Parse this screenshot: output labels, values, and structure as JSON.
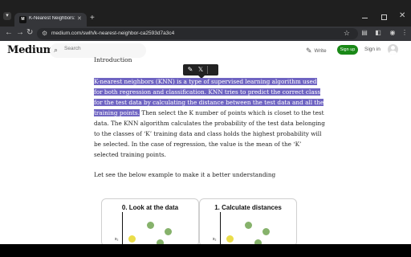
{
  "browser": {
    "tab_title": "K-Nearest Neighbors: A comple",
    "tab_favicon": "M",
    "url": "medium.com/swlh/k-nearest-neighbor-ca2593d7a3c4"
  },
  "header": {
    "logo": "Medium",
    "search_placeholder": "Search",
    "write_label": "Write",
    "signup_label": "Sign up",
    "signin_label": "Sign in"
  },
  "article": {
    "section_heading": "Introduction",
    "para1_lines": [
      "K-nearest neighbors (KNN) is a type of supervised learning algorithm used",
      "for both regression and classification. KNN tries to predict the correct class",
      "for the test data by calculating the distance between the test data and all the",
      "training points."
    ],
    "para1_rest_first": " Then select the K number of points which is closet to the test",
    "para1_rest_lines": [
      "data. The KNN algorithm calculates the probability of the test data belonging",
      "to the classes of ‘K’ training data and class holds the highest probability will",
      "be selected. In the case of regression, the value is the mean of the ‘K’",
      "selected training points."
    ],
    "para2": "Let see the below example to make it a better understanding",
    "figures": [
      {
        "title": "0. Look at the data",
        "axis_label": "x₂"
      },
      {
        "title": "1. Calculate distances",
        "axis_label": "x₂"
      }
    ]
  },
  "colors": {
    "highlight": "#6f64c2",
    "signup": "#1a8917"
  }
}
